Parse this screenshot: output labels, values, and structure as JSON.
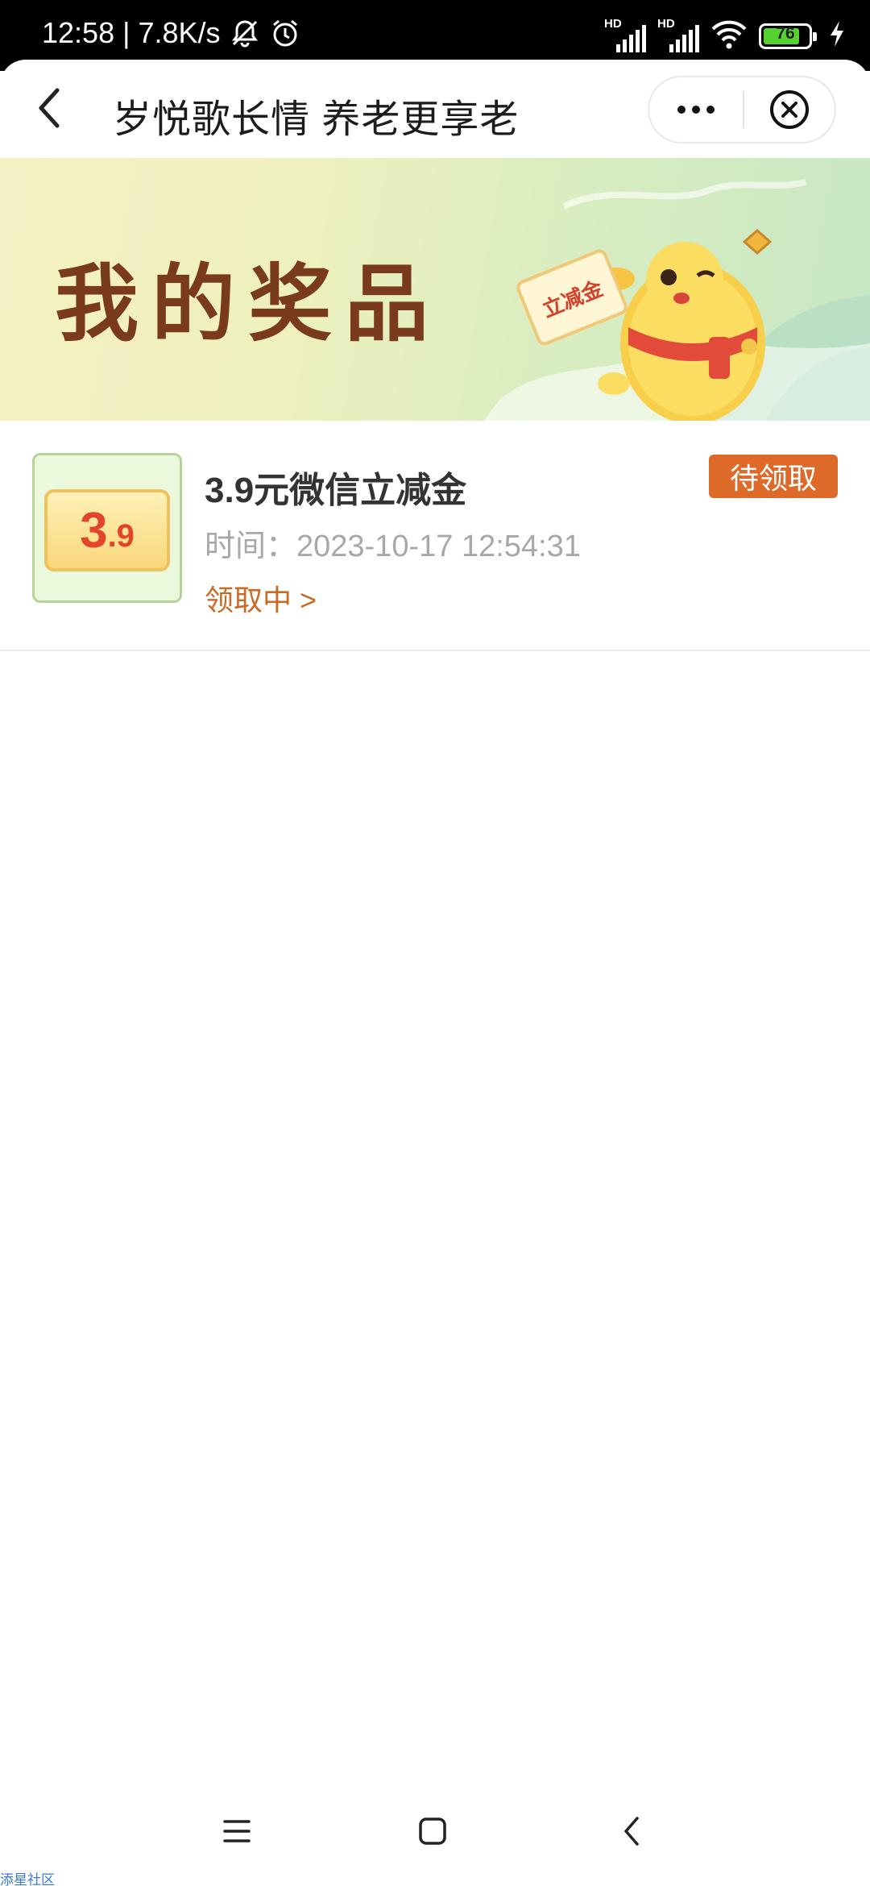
{
  "status_bar": {
    "time": "12:58",
    "separator": "|",
    "net_speed": "7.8K/s",
    "hd1": "HD",
    "hd2": "HD",
    "battery": "76",
    "icons": [
      "bell-off-icon",
      "alarm-icon",
      "signal-icon",
      "wifi-icon",
      "battery-icon",
      "charging-icon"
    ]
  },
  "header": {
    "title": "岁悦歌长情 养老更享老",
    "icons": [
      "back-icon",
      "more-icon",
      "close-icon"
    ]
  },
  "banner": {
    "title": "我的奖品",
    "tag": "立减金"
  },
  "prize": {
    "thumb_big": "3",
    "thumb_small": ".9",
    "name": "3.9元微信立减金",
    "time_label": "时间：",
    "time_value": "2023-10-17 12:54:31",
    "link": "领取中 >",
    "status": "待领取"
  },
  "nav": {
    "icons": [
      "menu-icon",
      "home-icon",
      "back-icon"
    ]
  },
  "watermark": "添星社区",
  "colors": {
    "accent": "#de6a2a",
    "link": "#c96a26",
    "banner_title": "#7a3a1d"
  }
}
